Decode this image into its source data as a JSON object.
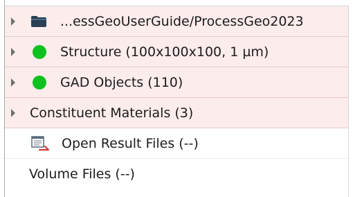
{
  "tree": {
    "items": [
      {
        "label": "...essGeoUserGuide/ProcessGeo2023",
        "icon": "folder-icon",
        "expandable": true
      },
      {
        "label": "Structure (100x100x100, 1 µm)",
        "icon": "status-dot-icon",
        "status_color": "#0fc11f",
        "expandable": true
      },
      {
        "label": "GAD Objects (110)",
        "icon": "status-dot-icon",
        "status_color": "#0fc11f",
        "expandable": true
      },
      {
        "label": "Constituent Materials (3)",
        "icon": null,
        "expandable": true
      },
      {
        "label": "Open Result Files (--)",
        "icon": "result-file-icon",
        "expandable": false
      },
      {
        "label": "Volume Files (--)",
        "icon": null,
        "expandable": false
      }
    ]
  },
  "colors": {
    "row_highlight": "#fdecec",
    "status_green": "#0fc11f",
    "folder": "#2b3f55"
  }
}
